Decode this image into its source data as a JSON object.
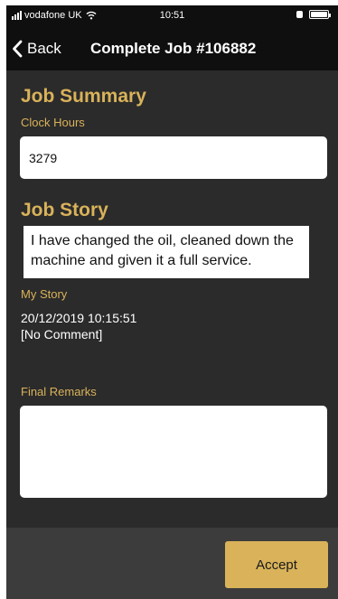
{
  "status_bar": {
    "carrier": "vodafone UK",
    "time": "10:51",
    "icons": [
      "signal-icon",
      "wifi-icon",
      "alarm-icon",
      "battery-icon"
    ]
  },
  "nav": {
    "back_label": "Back",
    "title": "Complete Job #106882"
  },
  "job_summary": {
    "heading": "Job Summary",
    "clock_hours_label": "Clock Hours",
    "clock_hours_value": "3279"
  },
  "job_story": {
    "heading": "Job Story",
    "story_text": "I have changed the oil, cleaned down the machine and given it a full service.",
    "my_story_label": "My Story",
    "timestamp": "20/12/2019 10:15:51",
    "comment": "[No Comment]"
  },
  "final_remarks": {
    "label": "Final Remarks",
    "value": ""
  },
  "footer": {
    "accept_label": "Accept"
  },
  "colors": {
    "accent": "#d9b25a",
    "background": "#2b2b2b",
    "bar": "#0f0f0f",
    "footer": "#3c3c3c"
  }
}
